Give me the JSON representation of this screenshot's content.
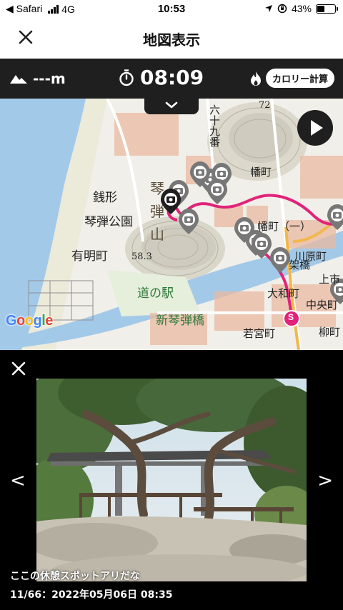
{
  "status_bar": {
    "back_app": "◀ Safari",
    "network": "4G",
    "time": "10:53",
    "battery": "43%",
    "battery_level": 0.43
  },
  "nav": {
    "title": "地図表示",
    "close_icon": "close-icon"
  },
  "info_bar": {
    "altitude": "---m",
    "elapsed": "08:09",
    "calorie_button": "カロリー計算"
  },
  "map": {
    "labels": [
      "銭形",
      "琴弾公園",
      "有明町",
      "道の駅",
      "新琴弾橋",
      "大和町",
      "川原町",
      "中央町",
      "若宮町",
      "上市",
      "柳町",
      "六十九番",
      "幡町",
      "幡町（一）",
      "架橋",
      "琴",
      "弾",
      "山",
      "58.3",
      "72"
    ],
    "start_marker": "S",
    "attribution": "Google",
    "accent_route": "#e0247a"
  },
  "viewer": {
    "prev": "<",
    "next": ">",
    "caption": "ここの休憩スポットアリだな",
    "meta": "11/66：2022年05月06日 08:35"
  }
}
